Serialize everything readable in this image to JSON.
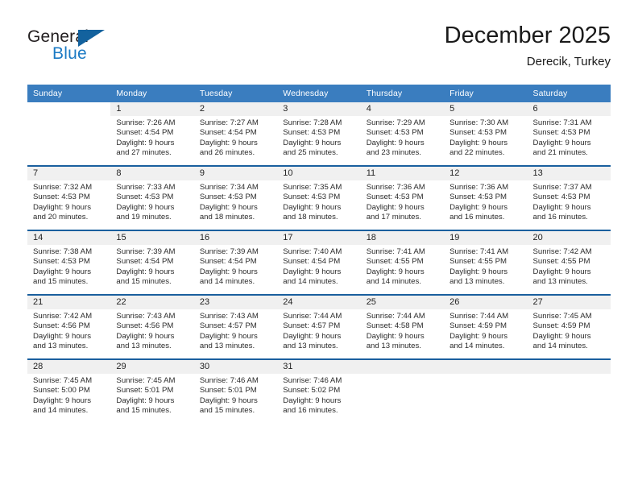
{
  "brand": {
    "word_top": "General",
    "word_bottom": "Blue",
    "triangle_color": "#13629e",
    "blue_color": "#1b7ac4"
  },
  "header": {
    "title": "December 2025",
    "subtitle": "Derecik, Turkey"
  },
  "theme": {
    "header_row_bg": "#3a7dbf",
    "week_divider": "#1a5f9e",
    "daynum_strip_bg": "#f0f0f0"
  },
  "weekdays": [
    "Sunday",
    "Monday",
    "Tuesday",
    "Wednesday",
    "Thursday",
    "Friday",
    "Saturday"
  ],
  "weeks": [
    [
      {
        "day": ""
      },
      {
        "day": "1",
        "sunrise": "Sunrise: 7:26 AM",
        "sunset": "Sunset: 4:54 PM",
        "daylight1": "Daylight: 9 hours",
        "daylight2": "and 27 minutes."
      },
      {
        "day": "2",
        "sunrise": "Sunrise: 7:27 AM",
        "sunset": "Sunset: 4:54 PM",
        "daylight1": "Daylight: 9 hours",
        "daylight2": "and 26 minutes."
      },
      {
        "day": "3",
        "sunrise": "Sunrise: 7:28 AM",
        "sunset": "Sunset: 4:53 PM",
        "daylight1": "Daylight: 9 hours",
        "daylight2": "and 25 minutes."
      },
      {
        "day": "4",
        "sunrise": "Sunrise: 7:29 AM",
        "sunset": "Sunset: 4:53 PM",
        "daylight1": "Daylight: 9 hours",
        "daylight2": "and 23 minutes."
      },
      {
        "day": "5",
        "sunrise": "Sunrise: 7:30 AM",
        "sunset": "Sunset: 4:53 PM",
        "daylight1": "Daylight: 9 hours",
        "daylight2": "and 22 minutes."
      },
      {
        "day": "6",
        "sunrise": "Sunrise: 7:31 AM",
        "sunset": "Sunset: 4:53 PM",
        "daylight1": "Daylight: 9 hours",
        "daylight2": "and 21 minutes."
      }
    ],
    [
      {
        "day": "7",
        "sunrise": "Sunrise: 7:32 AM",
        "sunset": "Sunset: 4:53 PM",
        "daylight1": "Daylight: 9 hours",
        "daylight2": "and 20 minutes."
      },
      {
        "day": "8",
        "sunrise": "Sunrise: 7:33 AM",
        "sunset": "Sunset: 4:53 PM",
        "daylight1": "Daylight: 9 hours",
        "daylight2": "and 19 minutes."
      },
      {
        "day": "9",
        "sunrise": "Sunrise: 7:34 AM",
        "sunset": "Sunset: 4:53 PM",
        "daylight1": "Daylight: 9 hours",
        "daylight2": "and 18 minutes."
      },
      {
        "day": "10",
        "sunrise": "Sunrise: 7:35 AM",
        "sunset": "Sunset: 4:53 PM",
        "daylight1": "Daylight: 9 hours",
        "daylight2": "and 18 minutes."
      },
      {
        "day": "11",
        "sunrise": "Sunrise: 7:36 AM",
        "sunset": "Sunset: 4:53 PM",
        "daylight1": "Daylight: 9 hours",
        "daylight2": "and 17 minutes."
      },
      {
        "day": "12",
        "sunrise": "Sunrise: 7:36 AM",
        "sunset": "Sunset: 4:53 PM",
        "daylight1": "Daylight: 9 hours",
        "daylight2": "and 16 minutes."
      },
      {
        "day": "13",
        "sunrise": "Sunrise: 7:37 AM",
        "sunset": "Sunset: 4:53 PM",
        "daylight1": "Daylight: 9 hours",
        "daylight2": "and 16 minutes."
      }
    ],
    [
      {
        "day": "14",
        "sunrise": "Sunrise: 7:38 AM",
        "sunset": "Sunset: 4:53 PM",
        "daylight1": "Daylight: 9 hours",
        "daylight2": "and 15 minutes."
      },
      {
        "day": "15",
        "sunrise": "Sunrise: 7:39 AM",
        "sunset": "Sunset: 4:54 PM",
        "daylight1": "Daylight: 9 hours",
        "daylight2": "and 15 minutes."
      },
      {
        "day": "16",
        "sunrise": "Sunrise: 7:39 AM",
        "sunset": "Sunset: 4:54 PM",
        "daylight1": "Daylight: 9 hours",
        "daylight2": "and 14 minutes."
      },
      {
        "day": "17",
        "sunrise": "Sunrise: 7:40 AM",
        "sunset": "Sunset: 4:54 PM",
        "daylight1": "Daylight: 9 hours",
        "daylight2": "and 14 minutes."
      },
      {
        "day": "18",
        "sunrise": "Sunrise: 7:41 AM",
        "sunset": "Sunset: 4:55 PM",
        "daylight1": "Daylight: 9 hours",
        "daylight2": "and 14 minutes."
      },
      {
        "day": "19",
        "sunrise": "Sunrise: 7:41 AM",
        "sunset": "Sunset: 4:55 PM",
        "daylight1": "Daylight: 9 hours",
        "daylight2": "and 13 minutes."
      },
      {
        "day": "20",
        "sunrise": "Sunrise: 7:42 AM",
        "sunset": "Sunset: 4:55 PM",
        "daylight1": "Daylight: 9 hours",
        "daylight2": "and 13 minutes."
      }
    ],
    [
      {
        "day": "21",
        "sunrise": "Sunrise: 7:42 AM",
        "sunset": "Sunset: 4:56 PM",
        "daylight1": "Daylight: 9 hours",
        "daylight2": "and 13 minutes."
      },
      {
        "day": "22",
        "sunrise": "Sunrise: 7:43 AM",
        "sunset": "Sunset: 4:56 PM",
        "daylight1": "Daylight: 9 hours",
        "daylight2": "and 13 minutes."
      },
      {
        "day": "23",
        "sunrise": "Sunrise: 7:43 AM",
        "sunset": "Sunset: 4:57 PM",
        "daylight1": "Daylight: 9 hours",
        "daylight2": "and 13 minutes."
      },
      {
        "day": "24",
        "sunrise": "Sunrise: 7:44 AM",
        "sunset": "Sunset: 4:57 PM",
        "daylight1": "Daylight: 9 hours",
        "daylight2": "and 13 minutes."
      },
      {
        "day": "25",
        "sunrise": "Sunrise: 7:44 AM",
        "sunset": "Sunset: 4:58 PM",
        "daylight1": "Daylight: 9 hours",
        "daylight2": "and 13 minutes."
      },
      {
        "day": "26",
        "sunrise": "Sunrise: 7:44 AM",
        "sunset": "Sunset: 4:59 PM",
        "daylight1": "Daylight: 9 hours",
        "daylight2": "and 14 minutes."
      },
      {
        "day": "27",
        "sunrise": "Sunrise: 7:45 AM",
        "sunset": "Sunset: 4:59 PM",
        "daylight1": "Daylight: 9 hours",
        "daylight2": "and 14 minutes."
      }
    ],
    [
      {
        "day": "28",
        "sunrise": "Sunrise: 7:45 AM",
        "sunset": "Sunset: 5:00 PM",
        "daylight1": "Daylight: 9 hours",
        "daylight2": "and 14 minutes."
      },
      {
        "day": "29",
        "sunrise": "Sunrise: 7:45 AM",
        "sunset": "Sunset: 5:01 PM",
        "daylight1": "Daylight: 9 hours",
        "daylight2": "and 15 minutes."
      },
      {
        "day": "30",
        "sunrise": "Sunrise: 7:46 AM",
        "sunset": "Sunset: 5:01 PM",
        "daylight1": "Daylight: 9 hours",
        "daylight2": "and 15 minutes."
      },
      {
        "day": "31",
        "sunrise": "Sunrise: 7:46 AM",
        "sunset": "Sunset: 5:02 PM",
        "daylight1": "Daylight: 9 hours",
        "daylight2": "and 16 minutes."
      },
      {
        "day": ""
      },
      {
        "day": ""
      },
      {
        "day": ""
      }
    ]
  ]
}
